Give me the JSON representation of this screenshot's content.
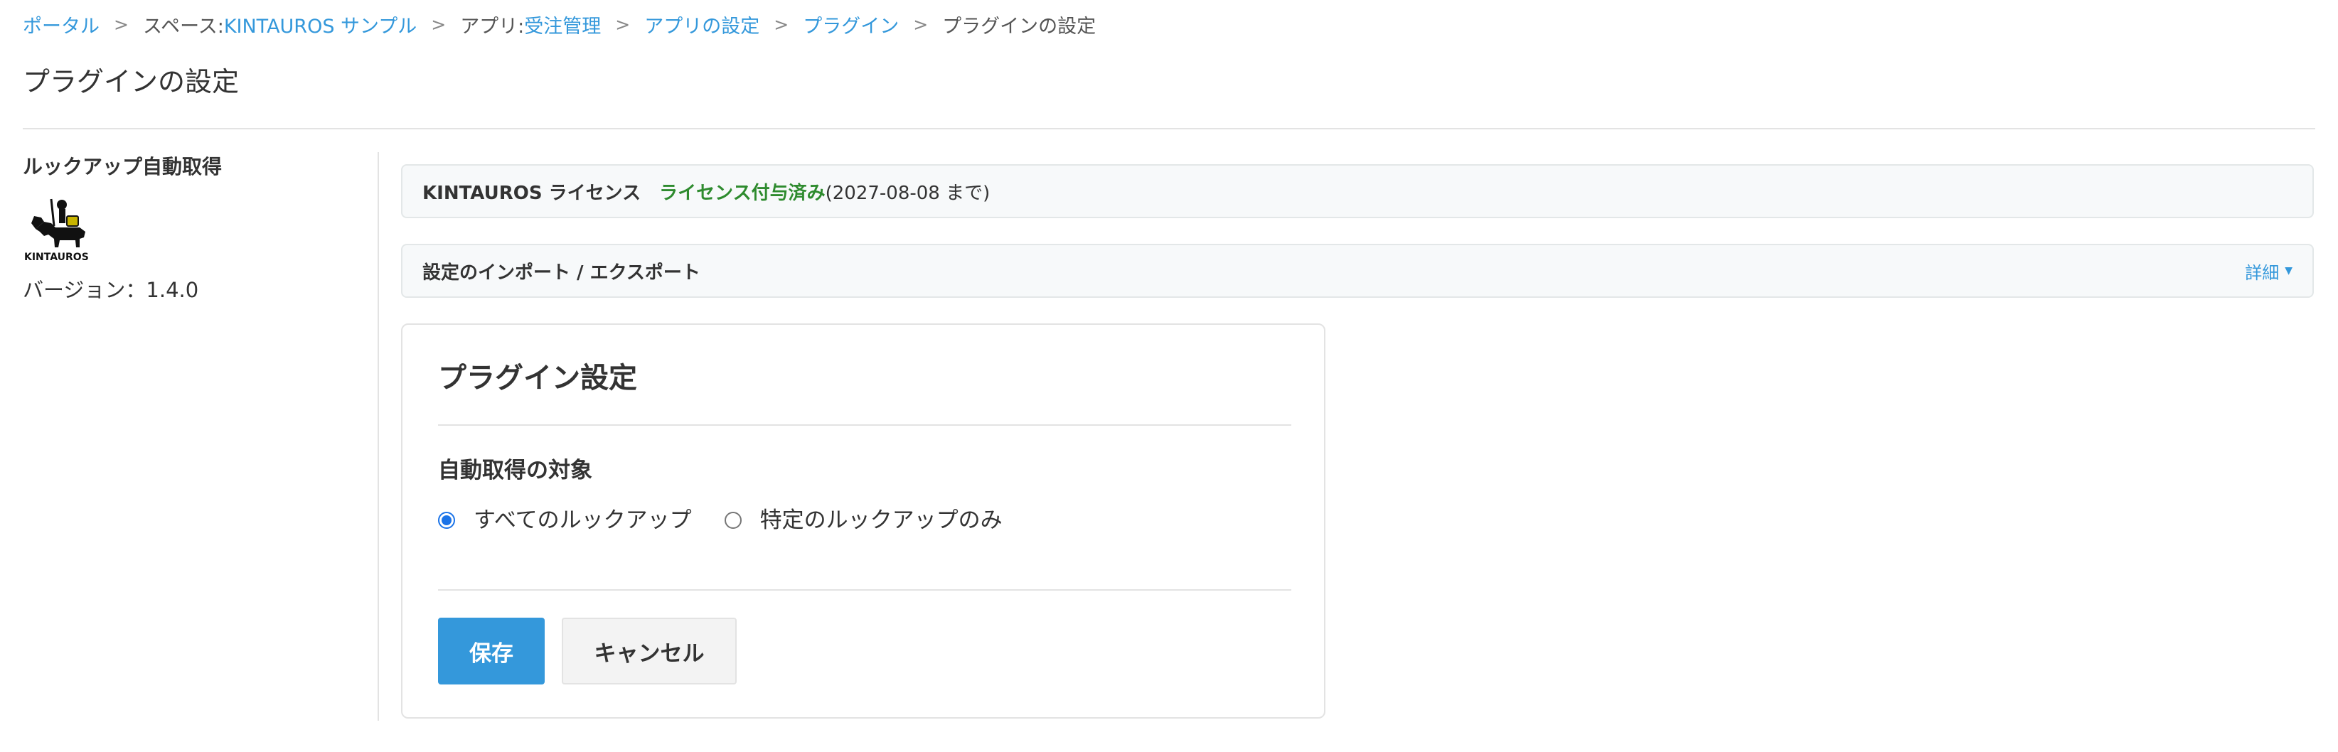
{
  "breadcrumb": {
    "portal": "ポータル",
    "space_prefix": "スペース: ",
    "space_name": "KINTAUROS サンプル",
    "app_prefix": "アプリ: ",
    "app_name": "受注管理",
    "app_settings": "アプリの設定",
    "plugins": "プラグイン",
    "current": "プラグインの設定",
    "separator": ">"
  },
  "page": {
    "title": "プラグインの設定"
  },
  "sidebar": {
    "plugin_name": "ルックアップ自動取得",
    "logo_text": "KINTAUROS",
    "version": "バージョン：1.4.0"
  },
  "license_panel": {
    "label": "KINTAUROS ライセンス",
    "status": "ライセンス付与済み",
    "until": "(2027-08-08 まで)"
  },
  "import_panel": {
    "label": "設定のインポート / エクスポート",
    "detail_label": "詳細",
    "detail_caret": "▼"
  },
  "settings": {
    "title": "プラグイン設定",
    "target_label": "自動取得の対象",
    "options": [
      {
        "label": "すべてのルックアップ",
        "checked": true
      },
      {
        "label": "特定のルックアップのみ",
        "checked": false
      }
    ],
    "save_label": "保存",
    "cancel_label": "キャンセル"
  },
  "colors": {
    "link": "#3498db",
    "license_ok": "#2e8b2e",
    "primary_button": "#3498db",
    "radio_checked": "#1a73e8"
  }
}
